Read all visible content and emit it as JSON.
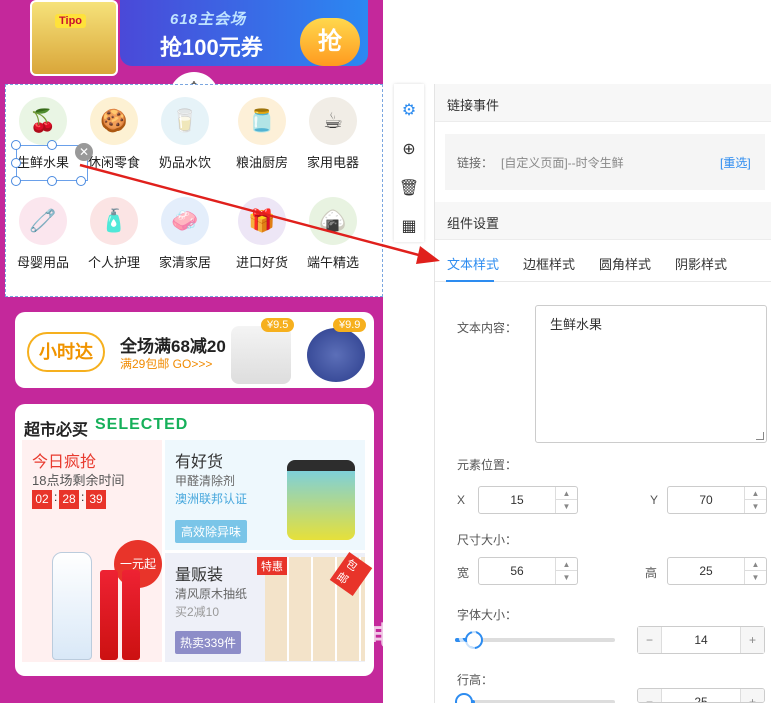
{
  "banner": {
    "brand": "Tipo",
    "headline": "618主会场",
    "coupon": "抢100元券",
    "grab": "抢"
  },
  "categories": [
    {
      "label": "生鲜水果",
      "icon": "lychee-icon",
      "color": "#e9f5e4"
    },
    {
      "label": "休闲零食",
      "icon": "snack-bag-icon",
      "color": "#fdf1d3"
    },
    {
      "label": "奶品水饮",
      "icon": "milk-icon",
      "color": "#e6f3f8"
    },
    {
      "label": "粮油厨房",
      "icon": "oil-bottle-icon",
      "color": "#fdf0d8"
    },
    {
      "label": "家用电器",
      "icon": "blender-icon",
      "color": "#f1ede6"
    },
    {
      "label": "母婴用品",
      "icon": "diaper-icon",
      "color": "#fbe6ee"
    },
    {
      "label": "个人护理",
      "icon": "shampoo-icon",
      "color": "#fbe4e4"
    },
    {
      "label": "家清家居",
      "icon": "detergent-icon",
      "color": "#e4eefb"
    },
    {
      "label": "进口好货",
      "icon": "gift-box-icon",
      "color": "#ede6f6"
    },
    {
      "label": "端午精选",
      "icon": "zongzi-icon",
      "color": "#e8f3e1"
    }
  ],
  "promo": {
    "logo": "小时达",
    "headline": "全场满68减20",
    "sub": "满29包邮 GO>>>",
    "price1": "¥9.5",
    "price2": "¥9.9"
  },
  "market": {
    "title": "超市必买",
    "subtitle": "SELECTED",
    "deal": {
      "title": "今日疯抢",
      "sub": "18点场剩余时间",
      "h": "02",
      "m": "28",
      "s": "39",
      "badge": "一元起"
    },
    "card2": {
      "title": "有好货",
      "line1": "甲醛清除剂",
      "line2": "澳洲联邦认证",
      "button": "高效除异味"
    },
    "card3": {
      "title": "量贩装",
      "line1": "清风原木抽纸",
      "line2": "买2减10",
      "button": "热卖339件",
      "tag1": "特惠",
      "tag2": "包邮"
    }
  },
  "toolbar": {
    "items": [
      "gear-icon",
      "add-circle-icon",
      "trash-icon",
      "layout-icon"
    ]
  },
  "panel": {
    "link_section": "链接事件",
    "link_key": "链接：",
    "link_value": "[自定义页面]--时令生鲜",
    "link_reselect": "[重选]",
    "component_section": "组件设置",
    "tabs": [
      "文本样式",
      "边框样式",
      "圆角样式",
      "阴影样式"
    ],
    "text_label": "文本内容：",
    "text_value": "生鲜水果",
    "pos_label": "元素位置：",
    "x_label": "X",
    "x_value": "15",
    "y_label": "Y",
    "y_value": "70",
    "size_label": "尺寸大小：",
    "w_label": "宽",
    "w_value": "56",
    "h_label": "高",
    "h_value": "25",
    "font_label": "字体大小：",
    "font_value": "14",
    "line_label": "行高：",
    "line_value": "25",
    "minus": "−",
    "plus": "+"
  },
  "watermark": "电话 QQ",
  "colors": {
    "accent": "#2d8cf0",
    "brand": "#c4289b",
    "red": "#e8342a"
  }
}
